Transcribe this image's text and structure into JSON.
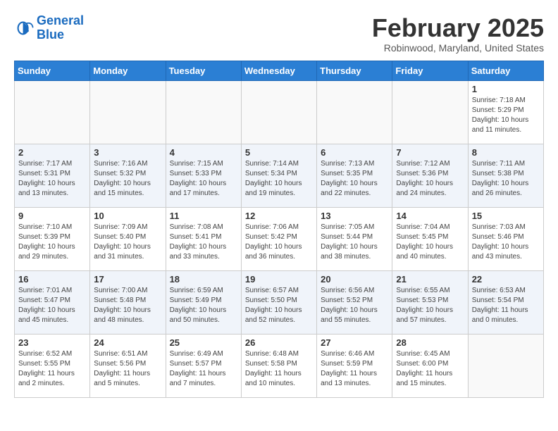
{
  "logo": {
    "line1": "General",
    "line2": "Blue"
  },
  "title": {
    "month_year": "February 2025",
    "location": "Robinwood, Maryland, United States"
  },
  "days_of_week": [
    "Sunday",
    "Monday",
    "Tuesday",
    "Wednesday",
    "Thursday",
    "Friday",
    "Saturday"
  ],
  "weeks": [
    [
      {
        "day": "",
        "info": ""
      },
      {
        "day": "",
        "info": ""
      },
      {
        "day": "",
        "info": ""
      },
      {
        "day": "",
        "info": ""
      },
      {
        "day": "",
        "info": ""
      },
      {
        "day": "",
        "info": ""
      },
      {
        "day": "1",
        "info": "Sunrise: 7:18 AM\nSunset: 5:29 PM\nDaylight: 10 hours and 11 minutes."
      }
    ],
    [
      {
        "day": "2",
        "info": "Sunrise: 7:17 AM\nSunset: 5:31 PM\nDaylight: 10 hours and 13 minutes."
      },
      {
        "day": "3",
        "info": "Sunrise: 7:16 AM\nSunset: 5:32 PM\nDaylight: 10 hours and 15 minutes."
      },
      {
        "day": "4",
        "info": "Sunrise: 7:15 AM\nSunset: 5:33 PM\nDaylight: 10 hours and 17 minutes."
      },
      {
        "day": "5",
        "info": "Sunrise: 7:14 AM\nSunset: 5:34 PM\nDaylight: 10 hours and 19 minutes."
      },
      {
        "day": "6",
        "info": "Sunrise: 7:13 AM\nSunset: 5:35 PM\nDaylight: 10 hours and 22 minutes."
      },
      {
        "day": "7",
        "info": "Sunrise: 7:12 AM\nSunset: 5:36 PM\nDaylight: 10 hours and 24 minutes."
      },
      {
        "day": "8",
        "info": "Sunrise: 7:11 AM\nSunset: 5:38 PM\nDaylight: 10 hours and 26 minutes."
      }
    ],
    [
      {
        "day": "9",
        "info": "Sunrise: 7:10 AM\nSunset: 5:39 PM\nDaylight: 10 hours and 29 minutes."
      },
      {
        "day": "10",
        "info": "Sunrise: 7:09 AM\nSunset: 5:40 PM\nDaylight: 10 hours and 31 minutes."
      },
      {
        "day": "11",
        "info": "Sunrise: 7:08 AM\nSunset: 5:41 PM\nDaylight: 10 hours and 33 minutes."
      },
      {
        "day": "12",
        "info": "Sunrise: 7:06 AM\nSunset: 5:42 PM\nDaylight: 10 hours and 36 minutes."
      },
      {
        "day": "13",
        "info": "Sunrise: 7:05 AM\nSunset: 5:44 PM\nDaylight: 10 hours and 38 minutes."
      },
      {
        "day": "14",
        "info": "Sunrise: 7:04 AM\nSunset: 5:45 PM\nDaylight: 10 hours and 40 minutes."
      },
      {
        "day": "15",
        "info": "Sunrise: 7:03 AM\nSunset: 5:46 PM\nDaylight: 10 hours and 43 minutes."
      }
    ],
    [
      {
        "day": "16",
        "info": "Sunrise: 7:01 AM\nSunset: 5:47 PM\nDaylight: 10 hours and 45 minutes."
      },
      {
        "day": "17",
        "info": "Sunrise: 7:00 AM\nSunset: 5:48 PM\nDaylight: 10 hours and 48 minutes."
      },
      {
        "day": "18",
        "info": "Sunrise: 6:59 AM\nSunset: 5:49 PM\nDaylight: 10 hours and 50 minutes."
      },
      {
        "day": "19",
        "info": "Sunrise: 6:57 AM\nSunset: 5:50 PM\nDaylight: 10 hours and 52 minutes."
      },
      {
        "day": "20",
        "info": "Sunrise: 6:56 AM\nSunset: 5:52 PM\nDaylight: 10 hours and 55 minutes."
      },
      {
        "day": "21",
        "info": "Sunrise: 6:55 AM\nSunset: 5:53 PM\nDaylight: 10 hours and 57 minutes."
      },
      {
        "day": "22",
        "info": "Sunrise: 6:53 AM\nSunset: 5:54 PM\nDaylight: 11 hours and 0 minutes."
      }
    ],
    [
      {
        "day": "23",
        "info": "Sunrise: 6:52 AM\nSunset: 5:55 PM\nDaylight: 11 hours and 2 minutes."
      },
      {
        "day": "24",
        "info": "Sunrise: 6:51 AM\nSunset: 5:56 PM\nDaylight: 11 hours and 5 minutes."
      },
      {
        "day": "25",
        "info": "Sunrise: 6:49 AM\nSunset: 5:57 PM\nDaylight: 11 hours and 7 minutes."
      },
      {
        "day": "26",
        "info": "Sunrise: 6:48 AM\nSunset: 5:58 PM\nDaylight: 11 hours and 10 minutes."
      },
      {
        "day": "27",
        "info": "Sunrise: 6:46 AM\nSunset: 5:59 PM\nDaylight: 11 hours and 13 minutes."
      },
      {
        "day": "28",
        "info": "Sunrise: 6:45 AM\nSunset: 6:00 PM\nDaylight: 11 hours and 15 minutes."
      },
      {
        "day": "",
        "info": ""
      }
    ]
  ]
}
